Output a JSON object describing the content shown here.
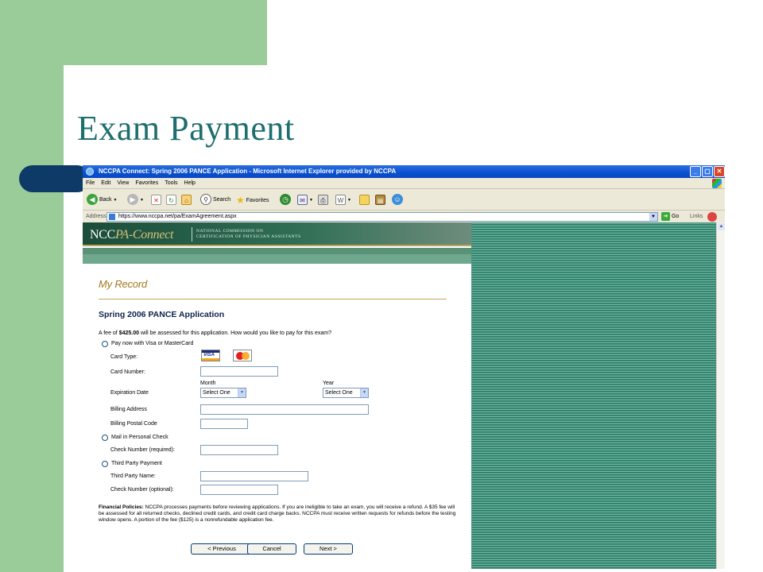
{
  "slide": {
    "title": "Exam Payment"
  },
  "browser": {
    "window_title": "NCCPA Connect: Spring 2006 PANCE Application - Microsoft Internet Explorer provided by NCCPA",
    "window_controls": {
      "minimize": "_",
      "maximize": "▢",
      "close": "✕"
    },
    "menu": [
      "File",
      "Edit",
      "View",
      "Favorites",
      "Tools",
      "Help"
    ],
    "toolbar": {
      "back": "Back",
      "search": "Search",
      "favorites": "Favorites"
    },
    "address": {
      "label": "Address",
      "url": "https://www.nccpa.net/pa/ExamAgreement.aspx",
      "go": "Go",
      "links": "Links"
    }
  },
  "site": {
    "logo_main": "NCC",
    "logo_accent": "PA-Connect",
    "org_line1": "National Commission on",
    "org_line2": "Certification of Physician Assistants"
  },
  "form": {
    "section": "My Record",
    "title": "Spring 2006 PANCE Application",
    "fee_prefix": "A fee of ",
    "fee_amount": "$425.00",
    "fee_suffix": " will be assessed for this application. How would you like to pay for this exam?",
    "option_card": "Pay now with Visa or MasterCard",
    "card_type_label": "Card Type:",
    "card_logos": {
      "visa": "VISA",
      "mastercard": "MasterCard"
    },
    "card_number_label": "Card Number:",
    "expiration_label": "Expiration Date",
    "month_label": "Month",
    "year_label": "Year",
    "month_value": "Select One",
    "year_value": "Select One",
    "billing_address_label": "Billing Address",
    "billing_postal_label": "Billing Postal Code",
    "option_check": "Mail in Personal Check",
    "check_number_required_label": "Check Number (required):",
    "option_third_party": "Third Party Payment",
    "third_party_name_label": "Third Party Name:",
    "check_number_optional_label": "Check Number (optional):",
    "policy_heading": "Financial Policies:",
    "policy_text": " NCCPA processes payments before reviewing applications. If you are ineligible to take an exam, you will receive a refund. A $35 fee will be assessed for all returned checks, declined credit cards, and credit card charge backs. NCCPA must receive written requests for refunds before the testing window opens. A portion of the fee ($125) is a nonrefundable application fee.",
    "buttons": {
      "previous": "< Previous",
      "cancel": "Cancel",
      "next": "Next >"
    }
  },
  "colors": {
    "slide_green": "#99cc99",
    "title_teal": "#1f6e6e",
    "deco_navy": "#0d3a66",
    "banner_green": "#1b4d3a",
    "record_gold": "#a27a1e",
    "form_title_navy": "#10214d"
  }
}
